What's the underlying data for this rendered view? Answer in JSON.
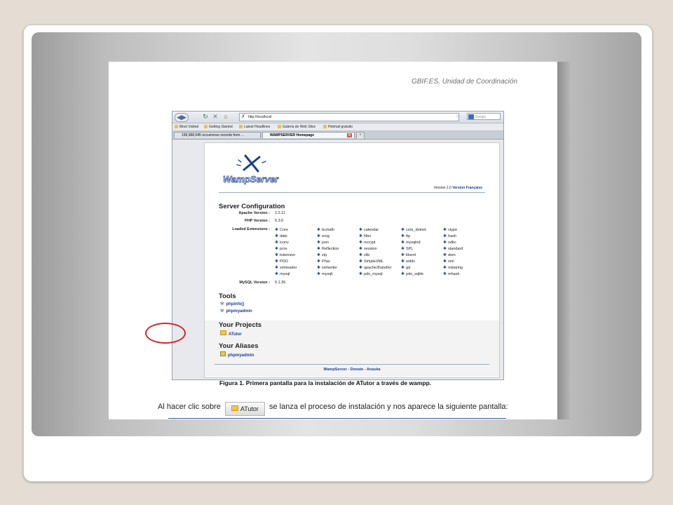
{
  "doc": {
    "header": "GBIF.ES, Unidad de Coordinación",
    "caption": "Figura 1. Primera pantalla para la instalación de ATutor a través de wampp.",
    "body_text_before": "Al hacer clic sobre",
    "inline_button_label": "ATutor",
    "body_text_after": "se lanza el proceso de instalación y nos aparece la siguiente pantalla:"
  },
  "browser": {
    "url": "http://localhost/",
    "search_placeholder": "Google",
    "bookmarks": [
      "Most Visited",
      "Getting Started",
      "Latest Headlines",
      "Galería de Web Slice",
      "Hotmail gratuito"
    ],
    "tabs": [
      {
        "label": "199,968,045 occurrence records from ...",
        "active": false
      },
      {
        "label": "WAMPSERVER Homepage",
        "active": true
      }
    ]
  },
  "wamp": {
    "logo_text": "WampServer",
    "version_text": "Version 2.0",
    "version_fr": "Version Française",
    "server_config_title": "Server Configuration",
    "apache_label": "Apache Version :",
    "apache_value": "2.2.11",
    "php_label": "PHP Version :",
    "php_value": "5.3.0",
    "ext_label": "Loaded Extensions :",
    "extensions": [
      [
        "Core",
        "bcmath",
        "calendar",
        "com_dotnet",
        "ctype"
      ],
      [
        "date",
        "ereg",
        "filter",
        "ftp",
        "hash"
      ],
      [
        "iconv",
        "json",
        "mcrypt",
        "mysqlnd",
        "odbc"
      ],
      [
        "pcre",
        "Reflection",
        "session",
        "SPL",
        "standard"
      ],
      [
        "tokenizer",
        "zip",
        "zlib",
        "libxml",
        "dom"
      ],
      [
        "PDO",
        "Phar",
        "SimpleXML",
        "wddx",
        "xml"
      ],
      [
        "xmlreader",
        "xmlwriter",
        "apache2handler",
        "gd",
        "mbstring"
      ],
      [
        "mysql",
        "mysqli",
        "pdo_mysql",
        "pdo_sqlite",
        "mhash"
      ]
    ],
    "mysql_label": "MySQL Version :",
    "mysql_value": "5.1.36",
    "tools_title": "Tools",
    "tools": [
      "phpinfo()",
      "phpmyadmin"
    ],
    "projects_title": "Your Projects",
    "projects": [
      "ATutor"
    ],
    "aliases_title": "Your Aliases",
    "aliases": [
      "phpmyadmin"
    ],
    "footer": "WampServer - Donate - Anaska"
  },
  "colors": {
    "highlight_circle": "#d3262b",
    "link": "#1a3f8f"
  }
}
